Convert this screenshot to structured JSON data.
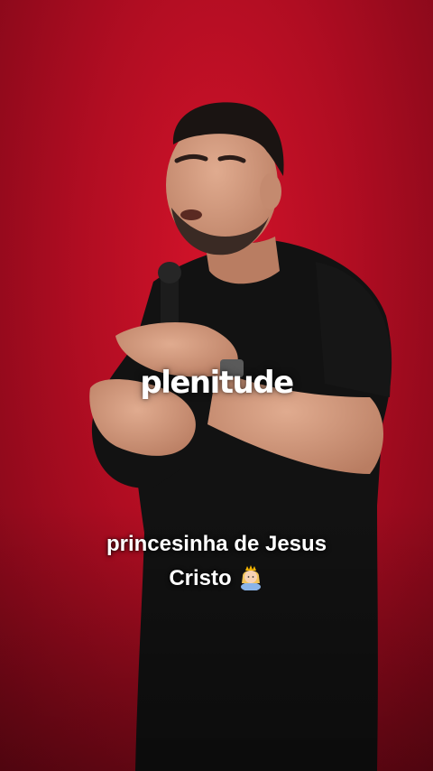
{
  "overlay": {
    "title": "plenitude",
    "subtitle_line1": "princesinha de Jesus",
    "subtitle_line2": "Cristo",
    "emoji_icon": "princess-emoji"
  },
  "colors": {
    "background": "#c8102e",
    "shirt": "#121212",
    "skin": "#d29a7d",
    "text": "#ffffff"
  }
}
